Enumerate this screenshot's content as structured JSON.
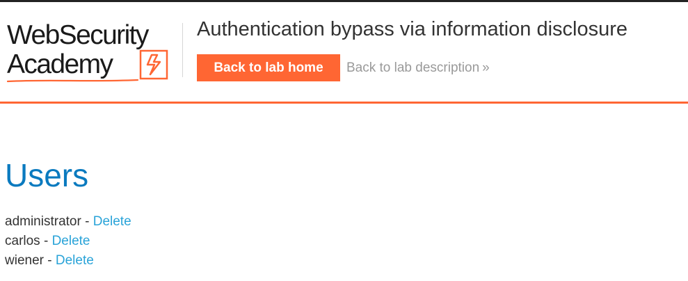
{
  "header": {
    "logo": {
      "line1": "WebSecurity",
      "line2": "Academy"
    },
    "lab_title": "Authentication bypass via information disclosure",
    "back_home_label": "Back to lab home",
    "back_description_label": "Back to lab description",
    "back_description_icon": "double-chevron-right-icon"
  },
  "main": {
    "title": "Users",
    "users": [
      {
        "name": "administrator",
        "separator": " - ",
        "delete_label": "Delete"
      },
      {
        "name": "carlos",
        "separator": " - ",
        "delete_label": "Delete"
      },
      {
        "name": "wiener",
        "separator": " - ",
        "delete_label": "Delete"
      }
    ]
  },
  "colors": {
    "accent": "#ff6633",
    "title_blue": "#0a7abf",
    "link_blue": "#29a3d8",
    "muted_link": "#999999"
  }
}
